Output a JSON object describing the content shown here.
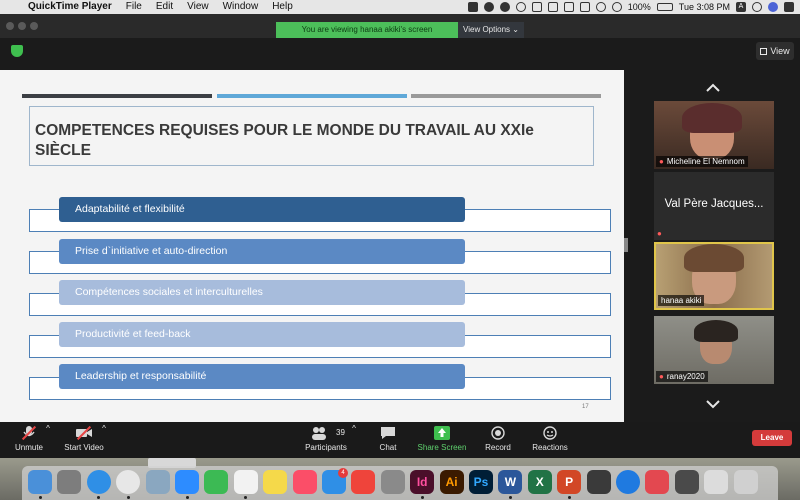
{
  "menubar": {
    "app_name": "QuickTime Player",
    "items": [
      "File",
      "Edit",
      "View",
      "Window",
      "Help"
    ],
    "battery": "100%",
    "clock": "Tue 3:08 PM",
    "input_source": "A"
  },
  "zoom": {
    "banner": "You are viewing hanaa akiki's screen",
    "view_options": "View Options",
    "view_button": "View"
  },
  "slide": {
    "title_line1": "COMPETENCES REQUISES POUR LE MONDE DU TRAVAIL AU XXIe",
    "title_line2": "SIÈCLE",
    "items": [
      "Adaptabilité et flexibilité",
      "Prise d`initiative et auto-direction",
      "Compétences sociales et interculturelles",
      "Productivité et feed-back",
      "Leadership et responsabilité"
    ],
    "page_number": "17",
    "colors": {
      "stripe_dark": "#3c3f44",
      "stripe_blue": "#5fa8d8",
      "stripe_gray": "#9a9a9a",
      "pill_dark": "#2f5f91",
      "pill_mid": "#5b89c4",
      "pill_light": "#a7bcdc"
    }
  },
  "participants": [
    {
      "name": "Micheline El Nemnom",
      "muted": true,
      "video": true
    },
    {
      "name": "Val Père Jacques...",
      "muted": true,
      "video": false
    },
    {
      "name": "hanaa akiki",
      "muted": false,
      "video": true,
      "active_speaker": true
    },
    {
      "name": "ranay2020",
      "muted": true,
      "video": true
    }
  ],
  "controls": {
    "unmute": "Unmute",
    "start_video": "Start Video",
    "participants": "Participants",
    "participant_count": "39",
    "chat": "Chat",
    "share_screen": "Share Screen",
    "record": "Record",
    "reactions": "Reactions",
    "leave": "Leave"
  },
  "dock": {
    "apps": [
      "Finder",
      "Launchpad",
      "Safari",
      "Chrome",
      "Preview",
      "Zoom",
      "FaceTime",
      "Photos",
      "Notes",
      "Music",
      "App Store",
      "AnyDesk",
      "System Preferences",
      "InDesign",
      "Illustrator",
      "Photoshop",
      "Word",
      "Excel",
      "PowerPoint",
      "Notability",
      "Accessibility",
      "Creative Cloud",
      "Utility",
      "Finder Window",
      "Trash"
    ],
    "labels": {
      "indesign": "Id",
      "illustrator": "Ai",
      "photoshop": "Ps",
      "word": "W",
      "excel": "X",
      "powerpoint": "P"
    },
    "app_store_badge": "4"
  }
}
